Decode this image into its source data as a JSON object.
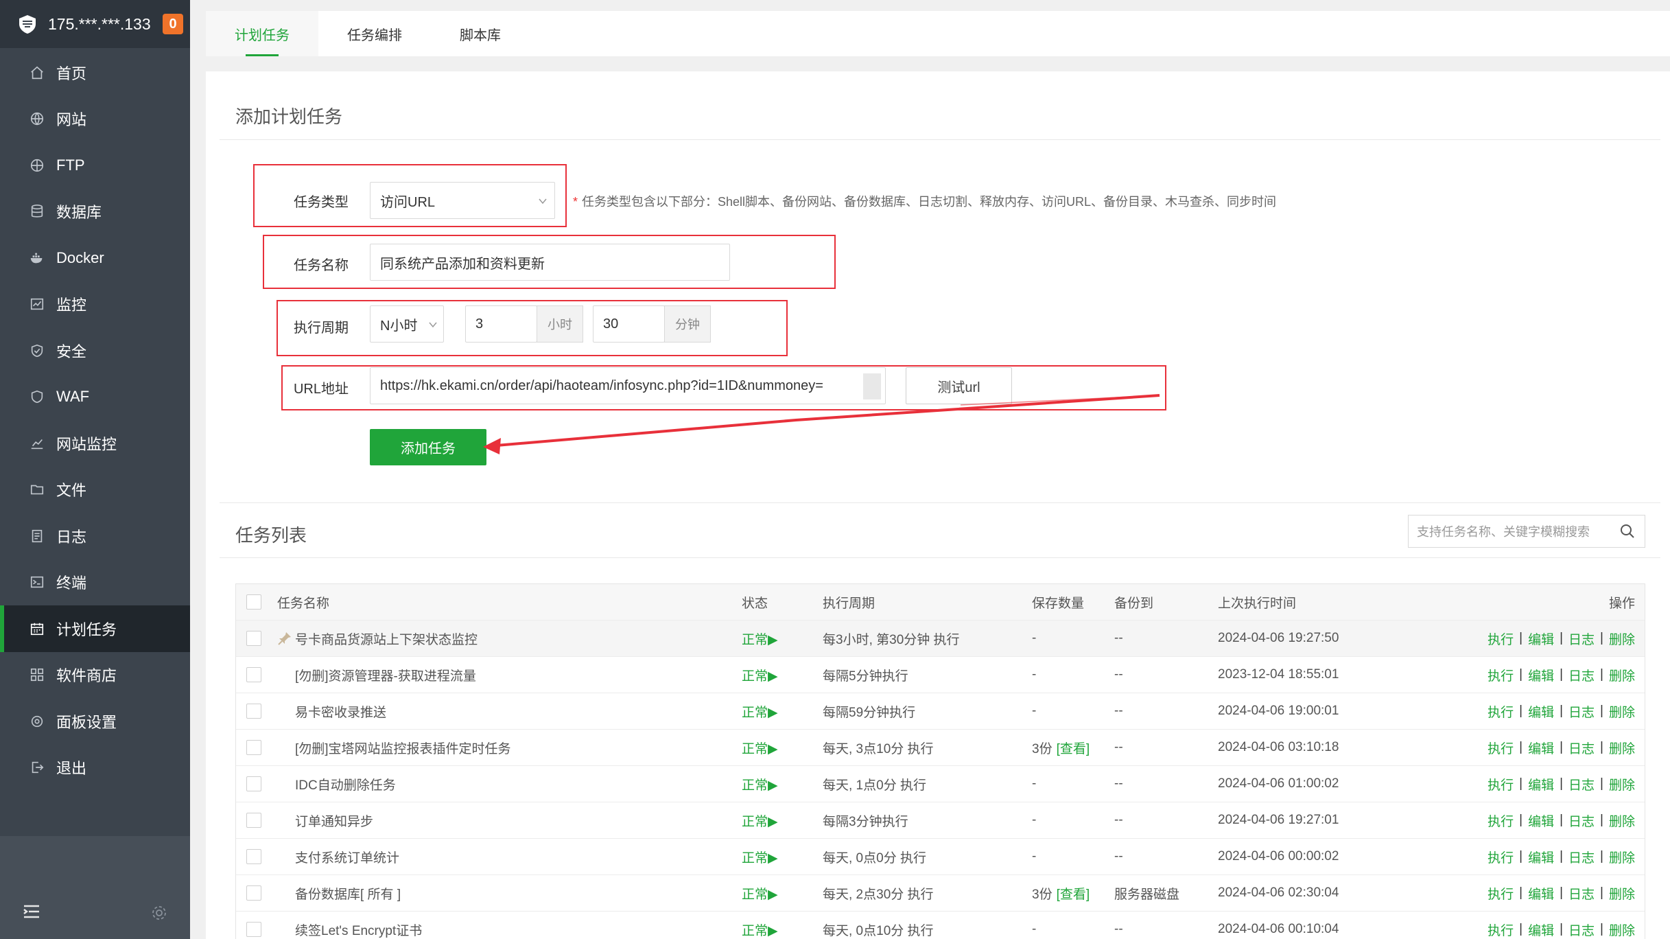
{
  "sidebar": {
    "server_ip": "175.***.***.133",
    "alert_count": "0",
    "items": [
      {
        "label": "首页",
        "icon": "home-icon"
      },
      {
        "label": "网站",
        "icon": "globe-icon"
      },
      {
        "label": "FTP",
        "icon": "ftp-globe-icon"
      },
      {
        "label": "数据库",
        "icon": "database-icon"
      },
      {
        "label": "Docker",
        "icon": "docker-icon"
      },
      {
        "label": "监控",
        "icon": "monitor-icon"
      },
      {
        "label": "安全",
        "icon": "shield-icon"
      },
      {
        "label": "WAF",
        "icon": "waf-shield-icon"
      },
      {
        "label": "网站监控",
        "icon": "chart-icon"
      },
      {
        "label": "文件",
        "icon": "folder-icon"
      },
      {
        "label": "日志",
        "icon": "log-icon"
      },
      {
        "label": "终端",
        "icon": "terminal-icon"
      },
      {
        "label": "计划任务",
        "icon": "calendar-icon"
      },
      {
        "label": "软件商店",
        "icon": "grid-icon"
      },
      {
        "label": "面板设置",
        "icon": "settings-icon"
      },
      {
        "label": "退出",
        "icon": "logout-icon"
      }
    ],
    "active_index": 12
  },
  "tabs": [
    "计划任务",
    "任务编排",
    "脚本库"
  ],
  "form": {
    "title": "添加计划任务",
    "type_label": "任务类型",
    "type_value": "访问URL",
    "type_hint": "任务类型包含以下部分：Shell脚本、备份网站、备份数据库、日志切割、释放内存、访问URL、备份目录、木马查杀、同步时间",
    "name_label": "任务名称",
    "name_value": "同系统产品添加和资料更新",
    "cycle_label": "执行周期",
    "cycle_type": "N小时",
    "hours_value": "3",
    "hours_unit": "小时",
    "minutes_value": "30",
    "minutes_unit": "分钟",
    "url_label": "URL地址",
    "url_value": "https://hk.ekami.cn/order/api/haoteam/infosync.php?id=1ID&nummoney=",
    "test_url_button": "测试url",
    "submit_button": "添加任务"
  },
  "list": {
    "title": "任务列表",
    "search_placeholder": "支持任务名称、关键字模糊搜索",
    "headers": {
      "name": "任务名称",
      "status": "状态",
      "cycle": "执行周期",
      "keep": "保存数量",
      "backup_to": "备份到",
      "last_run": "上次执行时间",
      "ops": "操作"
    },
    "ops": {
      "run": "执行",
      "edit": "编辑",
      "log": "日志",
      "delete": "删除"
    },
    "rows": [
      {
        "name": "号卡商品货源站上下架状态监控",
        "status": "正常▶",
        "cycle": "每3小时, 第30分钟 执行",
        "keep": "-",
        "keep_link": "",
        "backup_to": "--",
        "last_run": "2024-04-06 19:27:50",
        "pinned": true
      },
      {
        "name": "[勿删]资源管理器-获取进程流量",
        "status": "正常▶",
        "cycle": "每隔5分钟执行",
        "keep": "-",
        "keep_link": "",
        "backup_to": "--",
        "last_run": "2023-12-04 18:55:01",
        "pinned": false
      },
      {
        "name": "易卡密收录推送",
        "status": "正常▶",
        "cycle": "每隔59分钟执行",
        "keep": "-",
        "keep_link": "",
        "backup_to": "--",
        "last_run": "2024-04-06 19:00:01",
        "pinned": false
      },
      {
        "name": "[勿删]宝塔网站监控报表插件定时任务",
        "status": "正常▶",
        "cycle": "每天, 3点10分 执行",
        "keep": "3份",
        "keep_link": "[查看]",
        "backup_to": "--",
        "last_run": "2024-04-06 03:10:18",
        "pinned": false
      },
      {
        "name": "IDC自动删除任务",
        "status": "正常▶",
        "cycle": "每天, 1点0分 执行",
        "keep": "-",
        "keep_link": "",
        "backup_to": "--",
        "last_run": "2024-04-06 01:00:02",
        "pinned": false
      },
      {
        "name": "订单通知异步",
        "status": "正常▶",
        "cycle": "每隔3分钟执行",
        "keep": "-",
        "keep_link": "",
        "backup_to": "--",
        "last_run": "2024-04-06 19:27:01",
        "pinned": false
      },
      {
        "name": "支付系统订单统计",
        "status": "正常▶",
        "cycle": "每天, 0点0分 执行",
        "keep": "-",
        "keep_link": "",
        "backup_to": "--",
        "last_run": "2024-04-06 00:00:02",
        "pinned": false
      },
      {
        "name": "备份数据库[ 所有 ]",
        "status": "正常▶",
        "cycle": "每天, 2点30分 执行",
        "keep": "3份",
        "keep_link": "[查看]",
        "backup_to": "服务器磁盘",
        "last_run": "2024-04-06 02:30:04",
        "pinned": false
      },
      {
        "name": "续签Let's Encrypt证书",
        "status": "正常▶",
        "cycle": "每天, 0点10分 执行",
        "keep": "-",
        "keep_link": "",
        "backup_to": "--",
        "last_run": "2024-04-06 00:10:04",
        "pinned": false
      }
    ]
  },
  "colors": {
    "accent": "#20a53a",
    "annotation": "#e8303a",
    "sidebar_bg": "#3c444d"
  }
}
